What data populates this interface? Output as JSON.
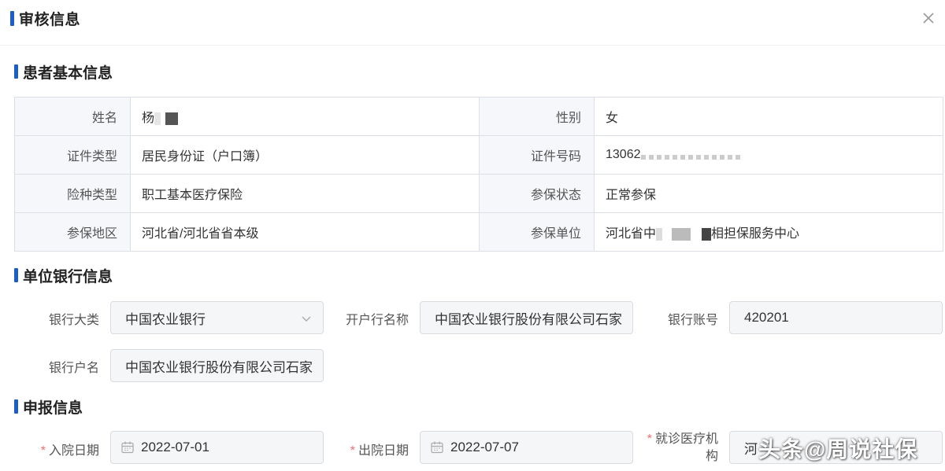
{
  "dialog": {
    "title": "审核信息"
  },
  "patient": {
    "title": "患者基本信息",
    "rows": [
      {
        "l1": "姓名",
        "v1": "杨",
        "l2": "性别",
        "v2": "女"
      },
      {
        "l1": "证件类型",
        "v1": "居民身份证（户口簿）",
        "l2": "证件号码",
        "v2": "13062"
      },
      {
        "l1": "险种类型",
        "v1": "职工基本医疗保险",
        "l2": "参保状态",
        "v2": "正常参保"
      },
      {
        "l1": "参保地区",
        "v1": "河北省/河北省省本级",
        "l2": "参保单位",
        "v2a": "河北省中",
        "v2b": "相担保服务中心"
      }
    ]
  },
  "bank": {
    "title": "单位银行信息",
    "category_label": "银行大类",
    "category_value": "中国农业银行",
    "branch_label": "开户行名称",
    "branch_value": "中国农业银行股份有限公司石家",
    "account_label": "银行账号",
    "account_value": "420201",
    "holder_label": "银行户名",
    "holder_value": "中国农业银行股份有限公司石家"
  },
  "report": {
    "title": "申报信息",
    "required_mark": "*",
    "admit_label": "入院日期",
    "admit_value": "2022-07-01",
    "discharge_label": "出院日期",
    "discharge_value": "2022-07-07",
    "hospital_label_1": "就诊医疗机",
    "hospital_label_2": "构",
    "hospital_value": "河"
  },
  "watermark": "头条@周说社保",
  "colors": {
    "accent": "#1b5ec8",
    "required": "#f56c6c"
  }
}
